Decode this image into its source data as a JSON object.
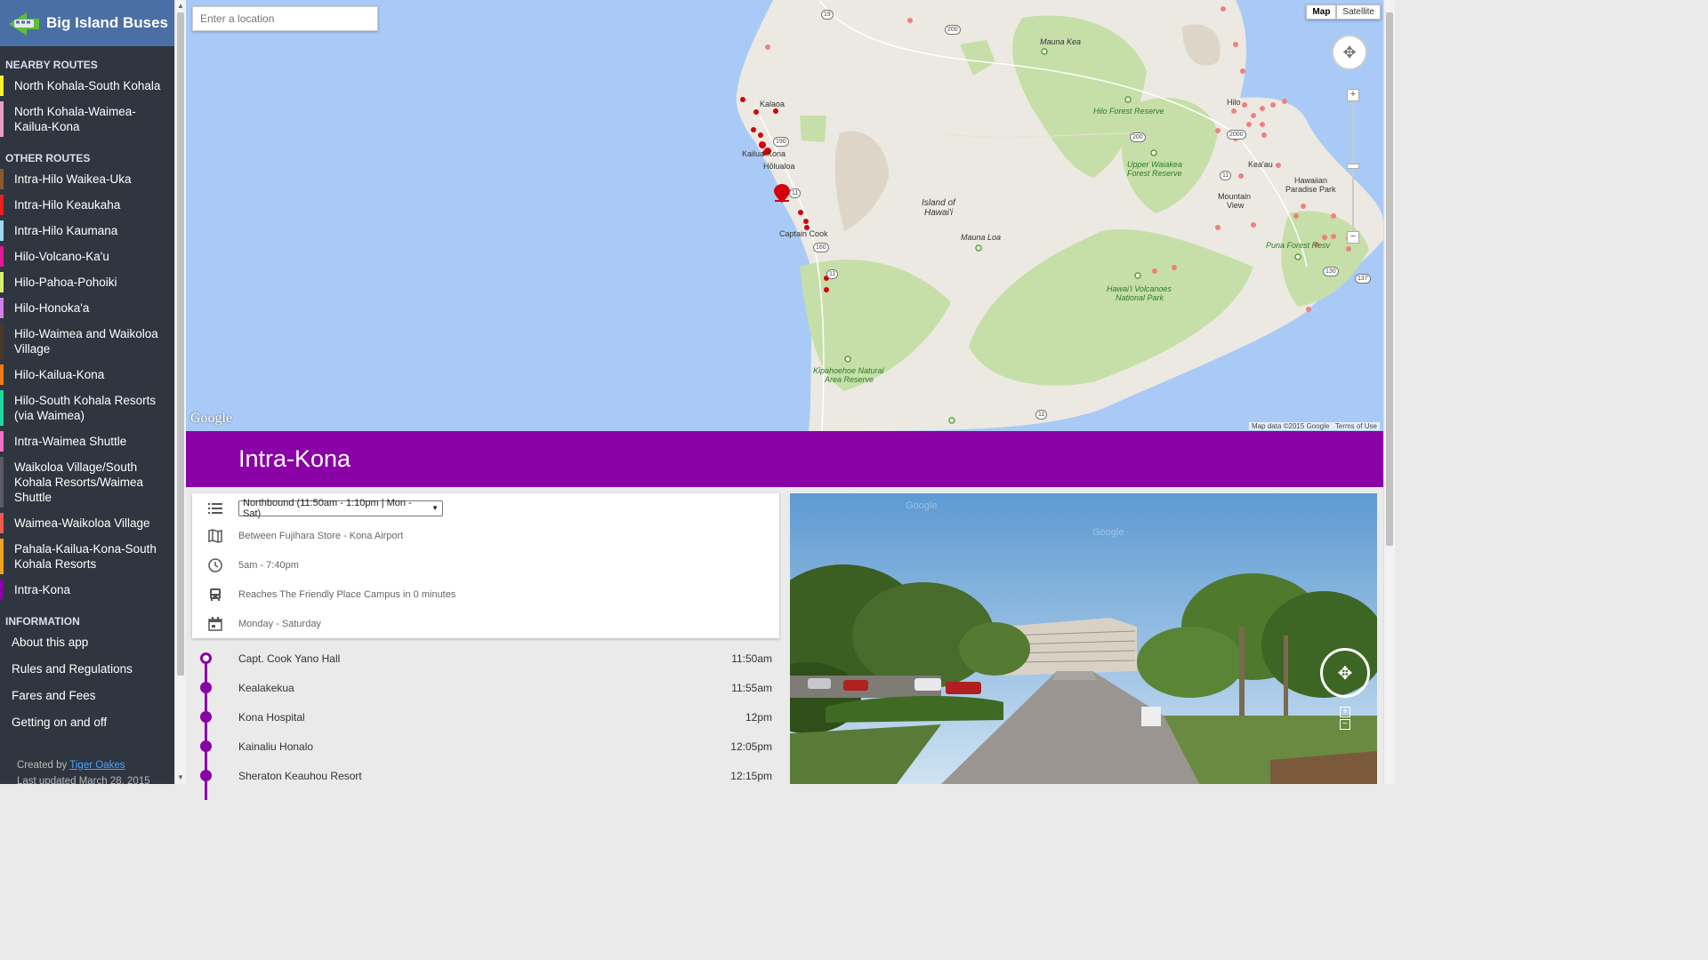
{
  "app": {
    "title": "Big Island Buses"
  },
  "sidebar": {
    "nearby_heading": "NEARBY ROUTES",
    "nearby": [
      {
        "label": "North Kohala-South Kohala",
        "color": "#f6f22f"
      },
      {
        "label": "North Kohala-Waimea-Kailua-Kona",
        "color": "#e8a0c8"
      }
    ],
    "other_heading": "OTHER ROUTES",
    "other": [
      {
        "label": "Intra-Hilo Waikea-Uka",
        "color": "#8b5a2b"
      },
      {
        "label": "Intra-Hilo Keaukaha",
        "color": "#e8211b"
      },
      {
        "label": "Intra-Hilo Kaumana",
        "color": "#9fd8f0"
      },
      {
        "label": "Hilo-Volcano-Ka'u",
        "color": "#e0189a"
      },
      {
        "label": "Hilo-Pahoa-Pohoiki",
        "color": "#d8f070"
      },
      {
        "label": "Hilo-Honoka'a",
        "color": "#d080e8"
      },
      {
        "label": "Hilo-Waimea and Waikoloa Village",
        "color": "#4a3a2a"
      },
      {
        "label": "Hilo-Kailua-Kona",
        "color": "#f07a1a"
      },
      {
        "label": "Hilo-South Kohala Resorts (via Waimea)",
        "color": "#20d8a0"
      },
      {
        "label": "Intra-Waimea Shuttle",
        "color": "#f070c8"
      },
      {
        "label": "Waikoloa Village/South Kohala Resorts/Waimea Shuttle",
        "color": "#5a5a6a"
      },
      {
        "label": "Waimea-Waikoloa Village",
        "color": "#f05a50"
      },
      {
        "label": "Pahala-Kailua-Kona-South Kohala Resorts",
        "color": "#f0a020"
      },
      {
        "label": "Intra-Kona",
        "color": "#8a01a5"
      }
    ],
    "info_heading": "INFORMATION",
    "info": [
      {
        "label": "About this app"
      },
      {
        "label": "Rules and Regulations"
      },
      {
        "label": "Fares and Fees"
      },
      {
        "label": "Getting on and off"
      }
    ],
    "credits": {
      "created_by": "Created by",
      "author": "Tiger Oakes",
      "updated": "Last updated March 28, 2015"
    }
  },
  "map": {
    "search_placeholder": "Enter a location",
    "type_map": "Map",
    "type_satellite": "Satellite",
    "attribution": "Map data ©2015 Google",
    "terms": "Terms of Use",
    "google": "Google",
    "labels": {
      "mauna_kea": "Mauna Kea",
      "kalaoa": "Kalaoa",
      "kailua_kona": "Kailua-Kona",
      "holualoa": "Hōlualoa",
      "captain_cook": "Captain Cook",
      "island1": "Island of",
      "island2": "Hawai'i",
      "mauna_loa": "Mauna Loa",
      "hilo_forest": "Hilo Forest Reserve",
      "hilo": "Hilo",
      "upper_waiakea1": "Upper Waiakea",
      "upper_waiakea2": "Forest Reserve",
      "keaau": "Kea'au",
      "hawaiian_paradise1": "Hawaiian",
      "hawaiian_paradise2": "Paradise Park",
      "mountain_view1": "Mountain",
      "mountain_view2": "View",
      "puna_forest": "Puna Forest Resv",
      "volcanoes1": "Hawai'i Volcanoes",
      "volcanoes2": "National Park",
      "kipahoehoe1": "Kīpahoehoe Natural",
      "kipahoehoe2": "Area Reserve"
    },
    "shields": [
      "19",
      "200",
      "190",
      "11",
      "160",
      "11",
      "200",
      "2000",
      "11",
      "130",
      "137",
      "11"
    ],
    "colors": {
      "ocean": "#a9caf6",
      "land": "#ece9e2",
      "green": "#c6dfa8",
      "stop": "#d4000d"
    }
  },
  "route": {
    "name": "Intra-Kona",
    "color": "#8a01a5",
    "direction": "Northbound (11:50am - 1:10pm | Mon - Sat)",
    "between": "Between Fujihara Store - Kona Airport",
    "hours": "5am - 7:40pm",
    "reaches": "Reaches The Friendly Place Campus in 0 minutes",
    "days": "Monday - Saturday",
    "stops": [
      {
        "name": "Capt. Cook Yano Hall",
        "time": "11:50am"
      },
      {
        "name": "Kealakekua",
        "time": "11:55am"
      },
      {
        "name": "Kona Hospital",
        "time": "12pm"
      },
      {
        "name": "Kainaliu Honalo",
        "time": "12:05pm"
      },
      {
        "name": "Sheraton Keauhou Resort",
        "time": "12:15pm"
      }
    ]
  },
  "streetview": {
    "faint1": "Google",
    "faint2": "Google"
  }
}
